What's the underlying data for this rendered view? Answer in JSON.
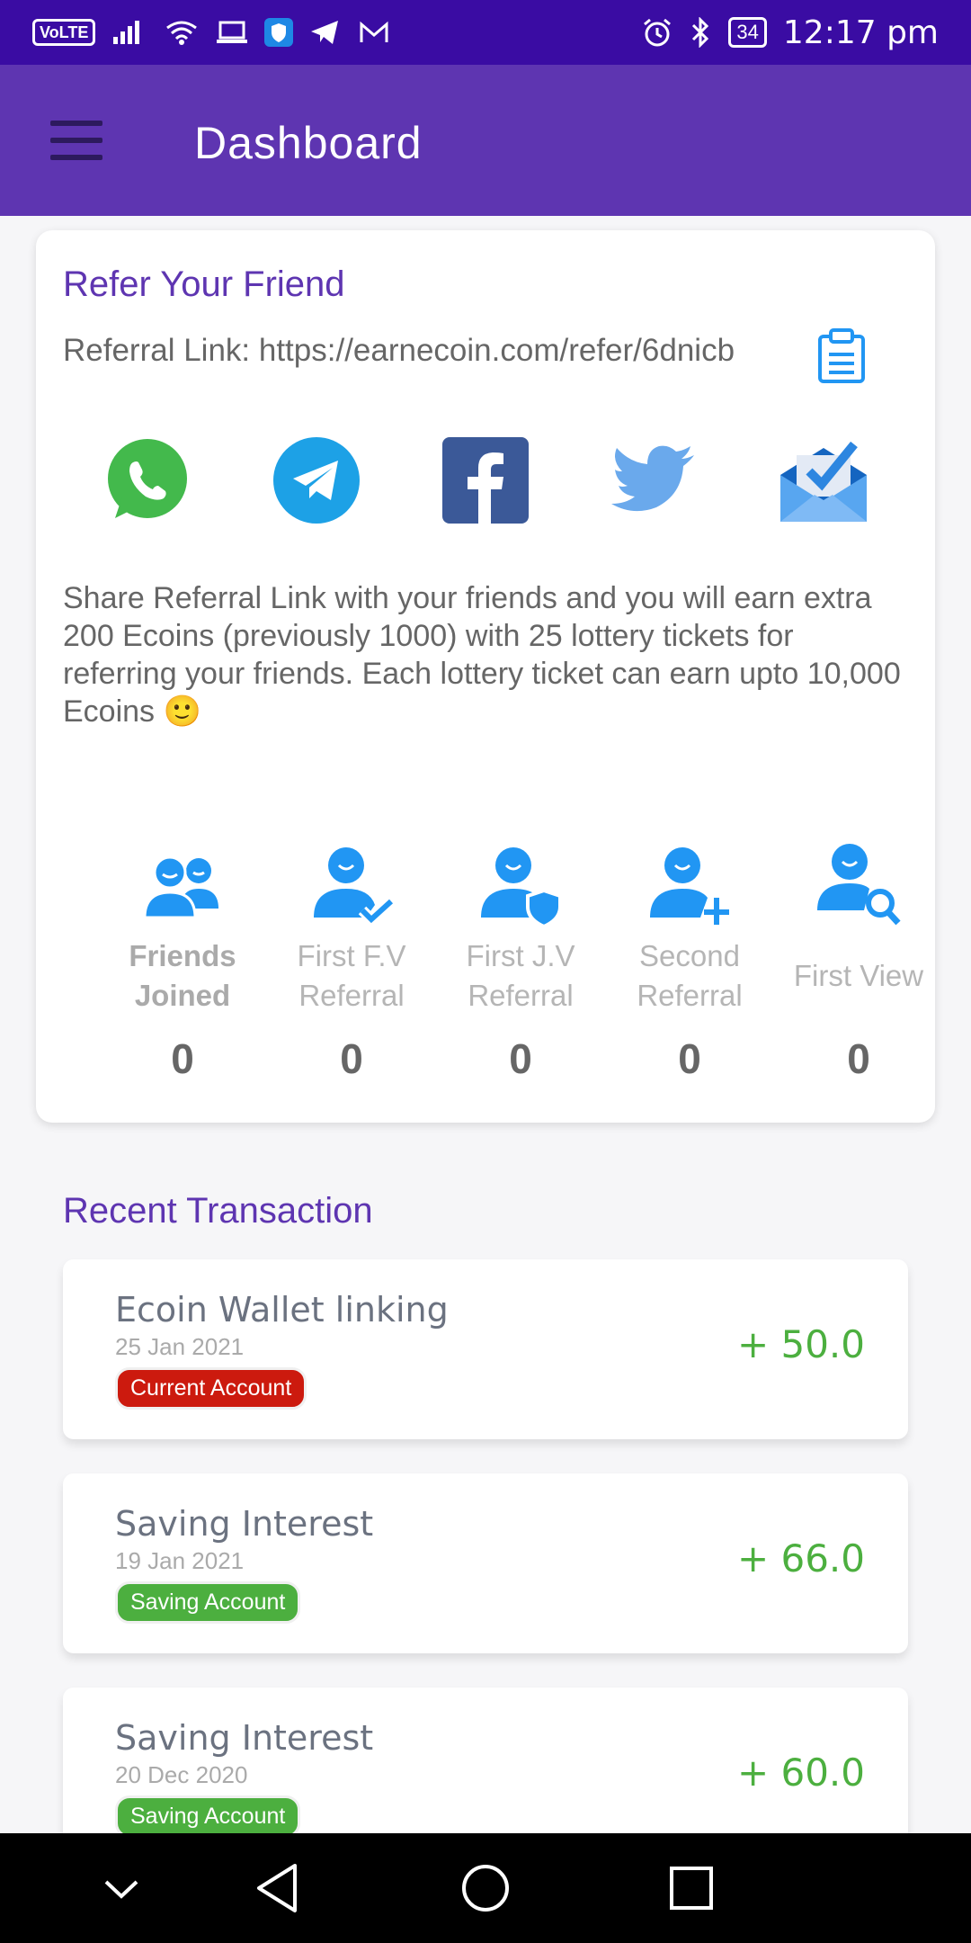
{
  "status_bar": {
    "volte": "VoLTE",
    "battery": "34",
    "time": "12:17 pm"
  },
  "app_bar": {
    "title": "Dashboard"
  },
  "refer": {
    "title": "Refer Your Friend",
    "link_text": "Referral Link: https://earnecoin.com/refer/6dnicb",
    "description": "Share Referral Link with your friends and you will earn extra 200 Ecoins (previously 1000) with 25 lottery tickets for referring your friends. Each lottery ticket can earn upto 10,000 Ecoins 🙂",
    "share_icons": [
      "whatsapp-icon",
      "telegram-icon",
      "facebook-icon",
      "twitter-icon",
      "email-icon"
    ],
    "stats": [
      {
        "label": "Friends Joined",
        "value": "0"
      },
      {
        "label": "First F.V Referral",
        "value": "0"
      },
      {
        "label": "First J.V Referral",
        "value": "0"
      },
      {
        "label": "Second Referral",
        "value": "0"
      },
      {
        "label": "First View",
        "value": "0"
      }
    ]
  },
  "recent": {
    "title": "Recent Transaction",
    "transactions": [
      {
        "title": "Ecoin Wallet linking",
        "date": "25 Jan 2021",
        "badge": "Current Account",
        "badge_color": "#cc1a0e",
        "amount": "+ 50.0"
      },
      {
        "title": "Saving Interest",
        "date": "19 Jan 2021",
        "badge": "Saving Account",
        "badge_color": "#4caf3f",
        "amount": "+ 66.0"
      },
      {
        "title": "Saving Interest",
        "date": "20 Dec 2020",
        "badge": "Saving Account",
        "badge_color": "#4caf3f",
        "amount": "+ 60.0"
      }
    ]
  },
  "colors": {
    "status_bar": "#3a0ca3",
    "app_bar": "#5e35b1",
    "accent_purple": "#5e35b1",
    "icon_blue": "#2196f3",
    "amount_green": "#4caf3f"
  }
}
